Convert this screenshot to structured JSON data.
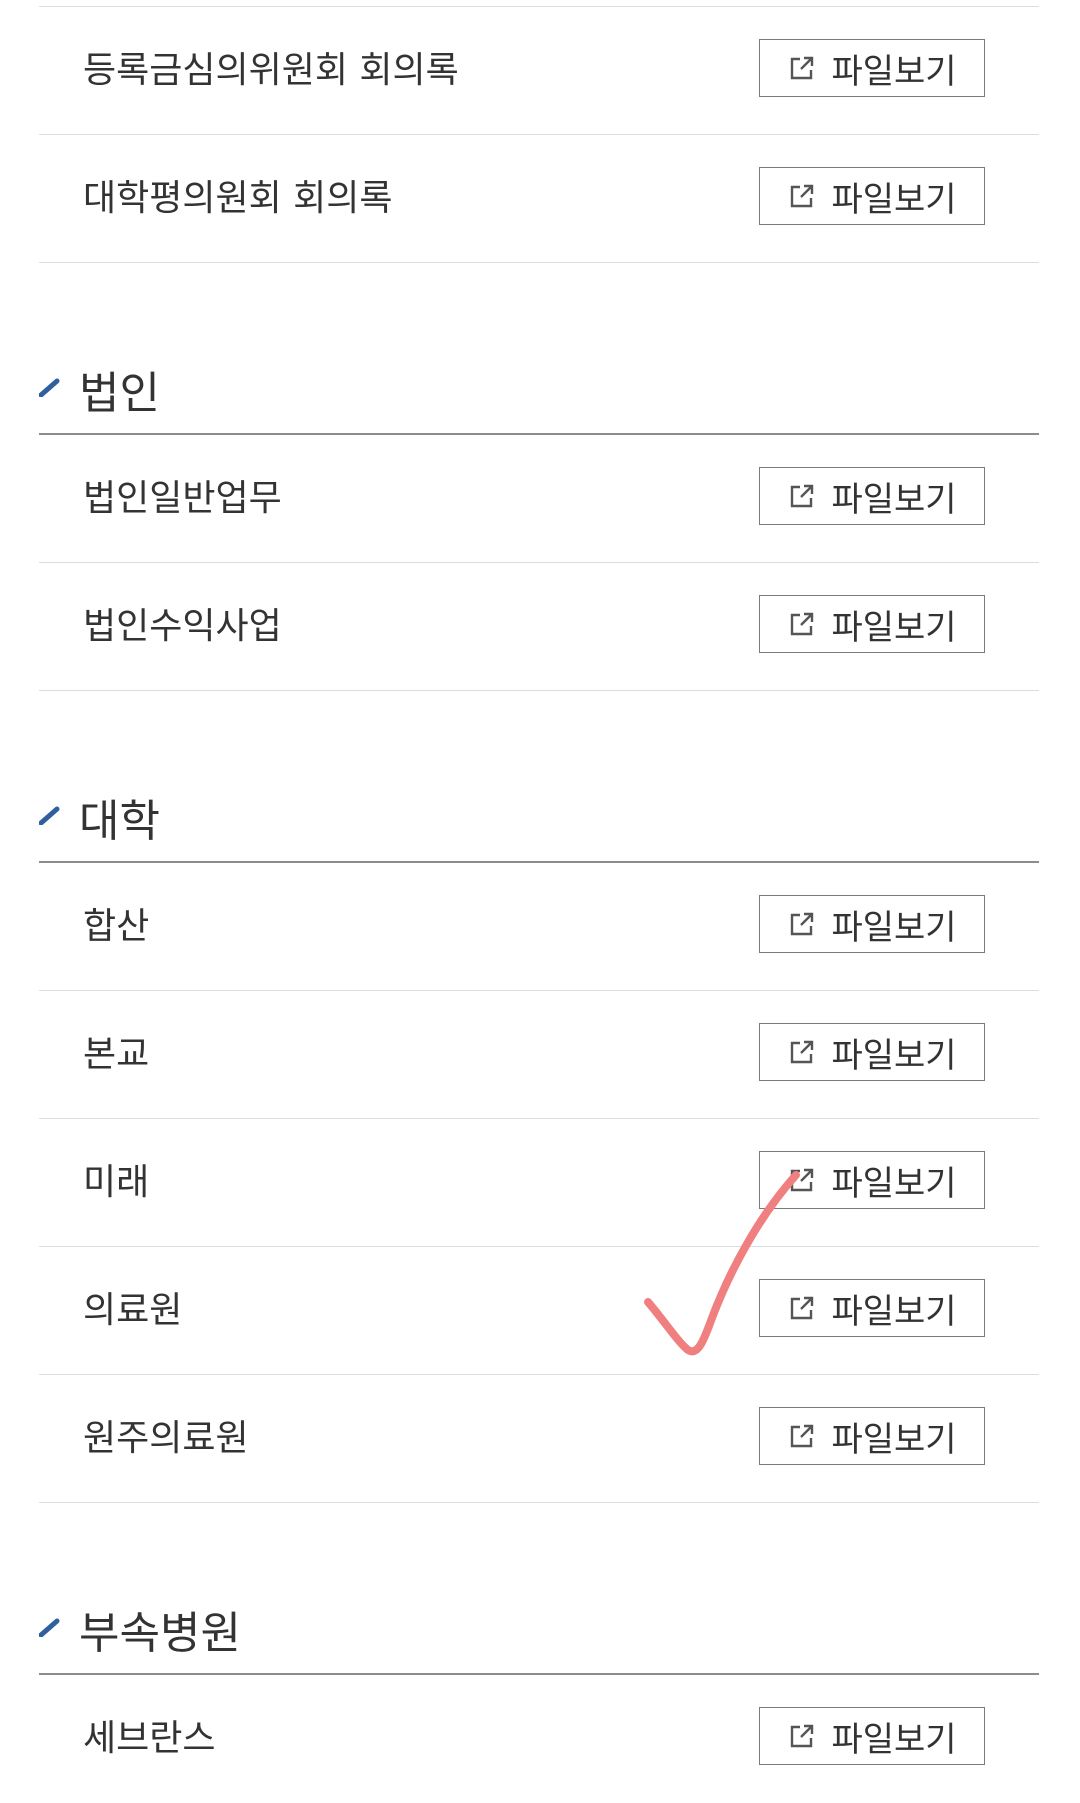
{
  "file_button_label": "파일보기",
  "rows_top": [
    {
      "label": "등록금심의위원회 회의록"
    },
    {
      "label": "대학평의원회 회의록"
    }
  ],
  "sections": [
    {
      "title": "법인",
      "rows": [
        {
          "label": "법인일반업무"
        },
        {
          "label": "법인수익사업"
        }
      ]
    },
    {
      "title": "대학",
      "rows": [
        {
          "label": "합산"
        },
        {
          "label": "본교"
        },
        {
          "label": "미래"
        },
        {
          "label": "의료원"
        },
        {
          "label": "원주의료원"
        }
      ]
    },
    {
      "title": "부속병원",
      "rows": [
        {
          "label": "세브란스"
        }
      ]
    }
  ],
  "colors": {
    "accent_mark": "#2f5f9e",
    "annotation": "#f08080",
    "border": "#dcdcdc"
  },
  "icons": {
    "section_marker": "pencil-slash-icon",
    "file_button_icon": "external-link-icon",
    "annotation": "checkmark-annotation"
  }
}
